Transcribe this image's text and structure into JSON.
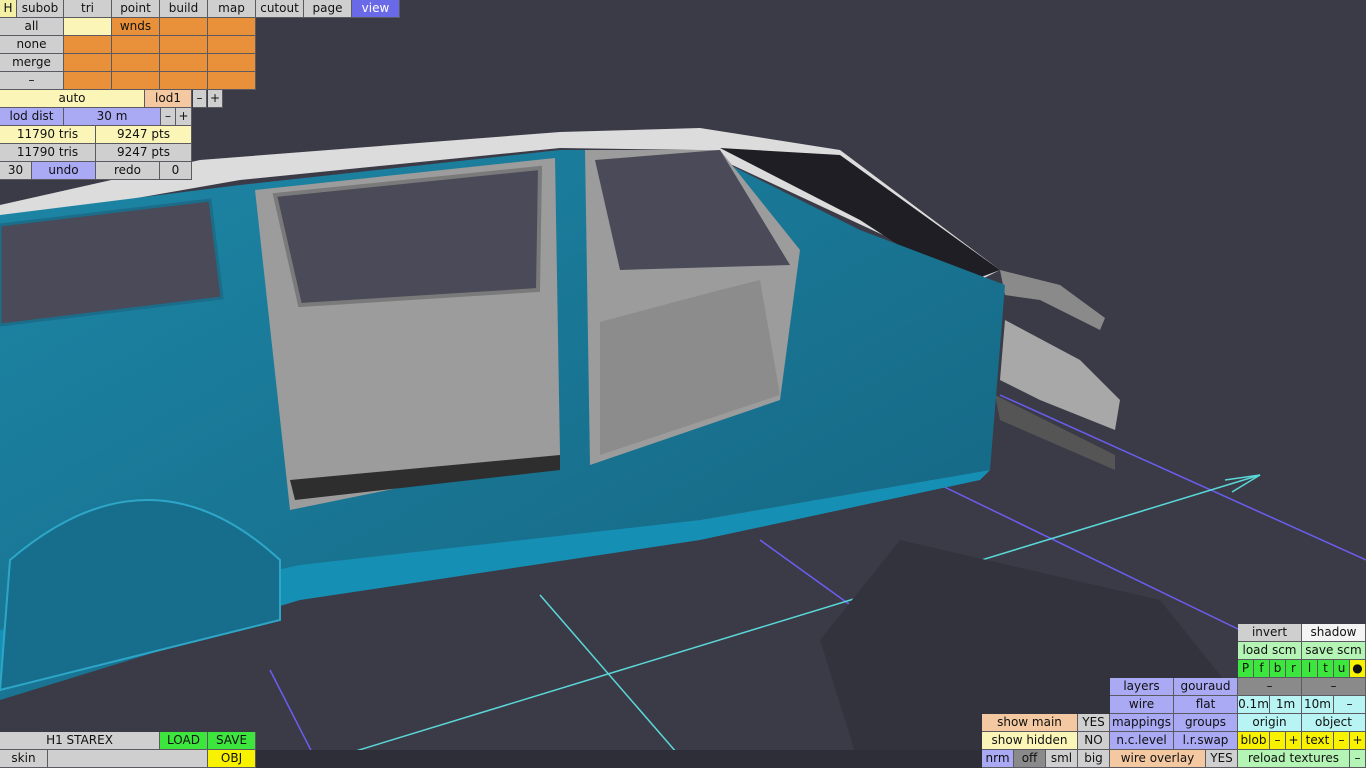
{
  "tabs": [
    "H",
    "subob",
    "tri",
    "point",
    "build",
    "map",
    "cutout",
    "page",
    "view"
  ],
  "select": {
    "all": "all",
    "wnds": "wnds",
    "none": "none",
    "merge": "merge",
    "minus": "–",
    "auto": "auto",
    "lod1": "lod1",
    "dec": "–",
    "inc": "+"
  },
  "lod": {
    "label": "lod dist",
    "value": "30 m",
    "dec": "–",
    "inc": "+",
    "tris1": "11790 tris",
    "pts1": "9247 pts",
    "tris2": "11790 tris",
    "pts2": "9247 pts"
  },
  "history": {
    "count": "30",
    "undo": "undo",
    "redo": "redo",
    "redo_count": "0"
  },
  "file": {
    "name": "H1 STAREX",
    "load": "LOAD",
    "save": "SAVE",
    "skin": "skin",
    "obj": "OBJ"
  },
  "view_panel": {
    "invert": "invert",
    "shadow": "shadow",
    "load_scm": "load scm",
    "save_scm": "save scm",
    "channels": [
      "P",
      "f",
      "b",
      "r",
      "l",
      "t",
      "u",
      "●"
    ],
    "minus": "–",
    "plus": "+",
    "layers": "layers",
    "gouraud": "gouraud",
    "wire": "wire",
    "flat": "flat",
    "scale_01": "0.1m",
    "scale_1": "1m",
    "scale_10": "10m",
    "mappings": "mappings",
    "groups": "groups",
    "origin": "origin",
    "object": "object",
    "show_main": "show main",
    "show_main_val": "YES",
    "show_hidden": "show hidden",
    "show_hidden_val": "NO",
    "nc_level": "n.c.level",
    "lr_swap": "l.r.swap",
    "blob": "blob",
    "text": "text",
    "nrm": "nrm",
    "off": "off",
    "sml": "sml",
    "big": "big",
    "wire_overlay": "wire overlay",
    "wire_overlay_val": "YES",
    "reload_textures": "reload textures"
  },
  "colors": {
    "body": "#1b7a9a",
    "interior": "#8a8a8a",
    "roof": "#dcdcdc",
    "bg": "#3b3b48",
    "grid_purple": "#6a5ef0",
    "grid_cyan": "#5ad8d8"
  }
}
